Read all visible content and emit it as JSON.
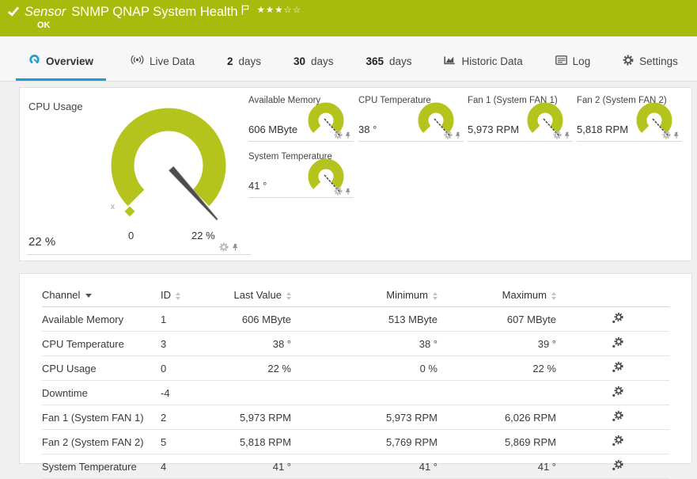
{
  "header": {
    "type_label": "Sensor",
    "title": "SNMP QNAP System Health",
    "status": "OK",
    "stars_filled": "★★★",
    "stars_empty": "☆☆",
    "bar_color": "#a7bb0d"
  },
  "tabs": {
    "overview": {
      "label": "Overview"
    },
    "live_data": {
      "label": "Live Data"
    },
    "days2": {
      "num": "2",
      "label": "days"
    },
    "days30": {
      "num": "30",
      "label": "days"
    },
    "days365": {
      "num": "365",
      "label": "days"
    },
    "historic": {
      "label": "Historic Data"
    },
    "log": {
      "label": "Log"
    },
    "settings": {
      "label": "Settings"
    }
  },
  "gauges": {
    "accent_color": "#b4c41d",
    "primary": {
      "title": "CPU Usage",
      "value": "22 %",
      "scale_min": "0",
      "scale_max": "22 %",
      "marker": "x"
    },
    "available_memory": {
      "title": "Available Memory",
      "value": "606 MByte"
    },
    "cpu_temperature": {
      "title": "CPU Temperature",
      "value": "38 °"
    },
    "fan1": {
      "title": "Fan 1 (System FAN 1)",
      "value": "5,973 RPM"
    },
    "fan2": {
      "title": "Fan 2 (System FAN 2)",
      "value": "5,818 RPM"
    },
    "system_temperature": {
      "title": "System Temperature",
      "value": "41 °"
    }
  },
  "table": {
    "headers": {
      "channel": "Channel",
      "id": "ID",
      "last": "Last Value",
      "min": "Minimum",
      "max": "Maximum"
    },
    "rows": [
      {
        "channel": "Available Memory",
        "id": "1",
        "last": "606 MByte",
        "min": "513 MByte",
        "max": "607 MByte"
      },
      {
        "channel": "CPU Temperature",
        "id": "3",
        "last": "38 °",
        "min": "38 °",
        "max": "39 °"
      },
      {
        "channel": "CPU Usage",
        "id": "0",
        "last": "22 %",
        "min": "0 %",
        "max": "22 %"
      },
      {
        "channel": "Downtime",
        "id": "-4",
        "last": "",
        "min": "",
        "max": ""
      },
      {
        "channel": "Fan 1 (System FAN 1)",
        "id": "2",
        "last": "5,973 RPM",
        "min": "5,973 RPM",
        "max": "6,026 RPM"
      },
      {
        "channel": "Fan 2 (System FAN 2)",
        "id": "5",
        "last": "5,818 RPM",
        "min": "5,769 RPM",
        "max": "5,869 RPM"
      },
      {
        "channel": "System Temperature",
        "id": "4",
        "last": "41 °",
        "min": "41 °",
        "max": "41 °"
      }
    ]
  }
}
